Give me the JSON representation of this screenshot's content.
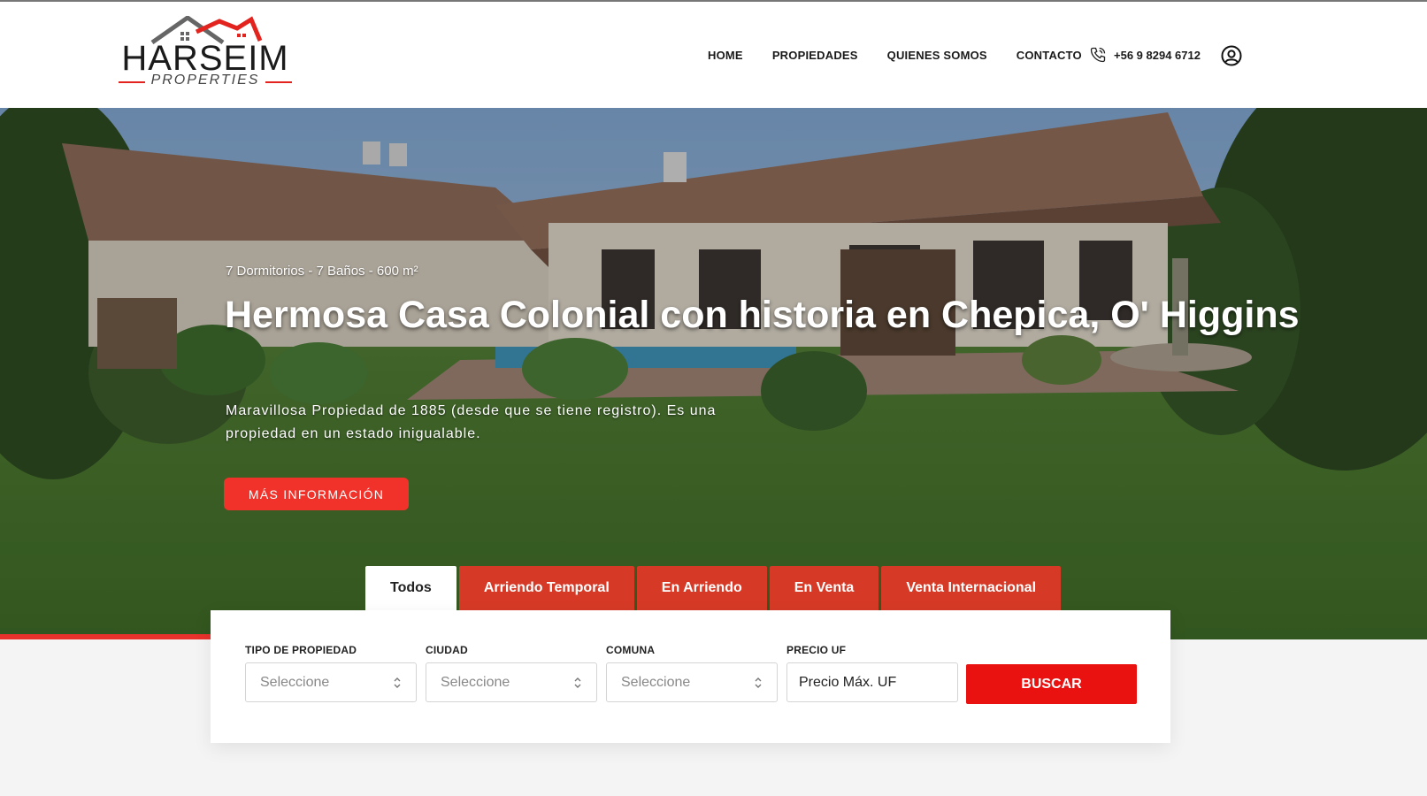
{
  "brand": {
    "name": "HARSEIM",
    "subtitle": "PROPERTIES",
    "accent": "#e3231e"
  },
  "nav": {
    "items": [
      "HOME",
      "PROPIEDADES",
      "QUIENES SOMOS",
      "CONTACTO"
    ],
    "phone": "+56 9 8294 6712",
    "phone_icon": "phone-icon",
    "user_icon": "user-circle-icon"
  },
  "hero": {
    "specs": "7 Dormitorios - 7 Baños - 600 m²",
    "title": "Hermosa Casa Colonial con historia en Chepica, O' Higgins",
    "description": "Maravillosa Propiedad de 1885 (desde que se tiene registro). Es una propiedad en un estado inigualable.",
    "button": "MÁS INFORMACIÓN",
    "button_color": "#f0322a"
  },
  "tabs": [
    {
      "label": "Todos",
      "active": true
    },
    {
      "label": "Arriendo Temporal",
      "active": false
    },
    {
      "label": "En Arriendo",
      "active": false
    },
    {
      "label": "En Venta",
      "active": false
    },
    {
      "label": "Venta Internacional",
      "active": false
    }
  ],
  "search": {
    "fields": [
      {
        "label": "TIPO DE PROPIEDAD",
        "value": "Seleccione"
      },
      {
        "label": "CIUDAD",
        "value": "Seleccione"
      },
      {
        "label": "COMUNA",
        "value": "Seleccione"
      }
    ],
    "price": {
      "label": "PRECIO UF",
      "placeholder": "Precio Máx. UF"
    },
    "button": "BUSCAR",
    "button_color": "#ea1111"
  }
}
